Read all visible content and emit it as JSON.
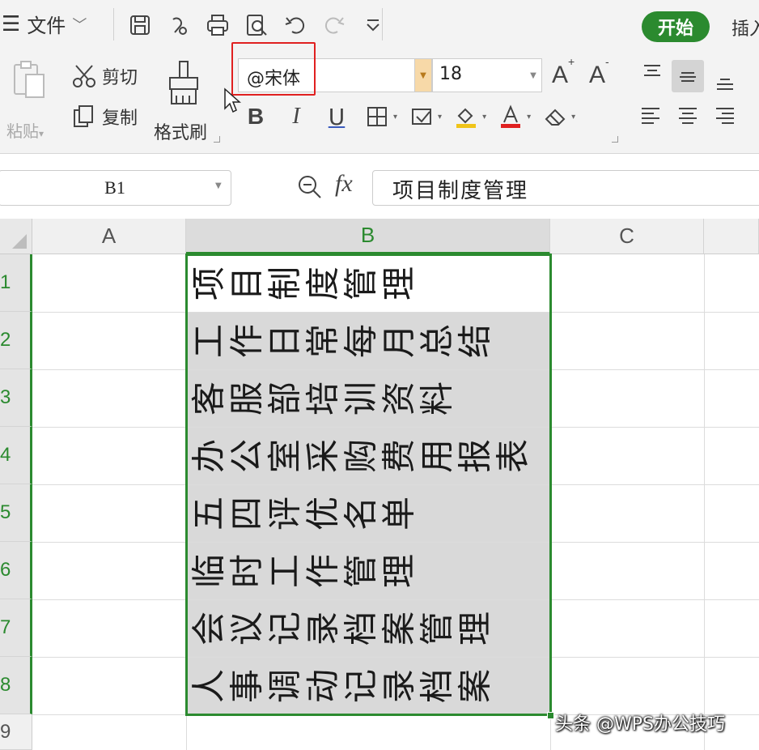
{
  "quick_access": {
    "file_menu_label": "文件",
    "tab_start_label": "开始",
    "tab_insert_label": "插入"
  },
  "clipboard": {
    "paste_label": "粘贴",
    "cut_label": "剪切",
    "copy_label": "复制",
    "format_painter_label": "格式刷"
  },
  "font": {
    "name": "@宋体",
    "size": "18",
    "bold_label": "B",
    "italic_label": "I",
    "underline_label": "U",
    "increase_label": "A",
    "decrease_label": "A"
  },
  "formula_bar": {
    "name_box": "B1",
    "fx_label": "fx",
    "content": "项目制度管理"
  },
  "grid": {
    "columns": [
      "A",
      "B",
      "C"
    ],
    "rows": [
      "1",
      "2",
      "3",
      "4",
      "5",
      "6",
      "7",
      "8",
      "9"
    ],
    "selected_column": "B",
    "cells_b": [
      "项目制度管理",
      "工作日常每月总结",
      "客服部培训资料",
      "办公室采购费用报表",
      "五四评优名单",
      "临时工作管理",
      "会议记录档案管理",
      "人事调动记录档案"
    ]
  },
  "colors": {
    "accent_green": "#2b8a2f",
    "highlight_red": "#e02020",
    "cell_fill": "#d9d9d9"
  },
  "watermark": "头条 @WPS办公技巧"
}
